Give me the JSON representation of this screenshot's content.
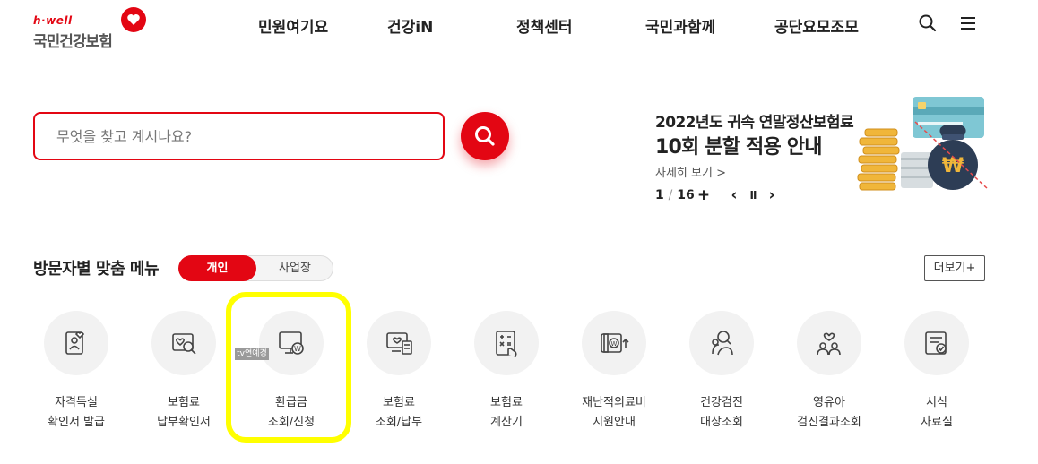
{
  "header": {
    "logo_sub": "h·well",
    "logo_main": "국민건강보험",
    "nav": [
      "민원여기요",
      "건강iN",
      "정책센터",
      "국민과함께",
      "공단요모조모"
    ],
    "icons": [
      "search-icon",
      "menu-icon"
    ]
  },
  "search": {
    "placeholder": "무엇을 찾고 계시나요?",
    "value": "",
    "button_icon": "search-icon"
  },
  "banner": {
    "subtitle": "2022년도 귀속 연말정산보험료",
    "title": "10회 분할 적용 안내",
    "more_link": "자세히 보기 >",
    "page_current": "1",
    "page_sep": "/",
    "page_total": "16",
    "controls": {
      "add": "+",
      "prev": "‹",
      "pause": "II",
      "next": "›"
    }
  },
  "persona": {
    "title": "방문자별 맞춤 메뉴",
    "tab_active": "개인",
    "tab_inactive": "사업장",
    "more_button": "더보기+",
    "items": [
      {
        "line1": "자격득실",
        "line2": "확인서 발급",
        "icon": "id-card-icon"
      },
      {
        "line1": "보험료",
        "line2": "납부확인서",
        "icon": "search-document-icon"
      },
      {
        "line1": "환급금",
        "line2": "조회/신청",
        "icon": "refund-monitor-icon"
      },
      {
        "line1": "보험료",
        "line2": "조회/납부",
        "icon": "payment-monitor-icon"
      },
      {
        "line1": "보험료",
        "line2": "계산기",
        "icon": "calculator-icon"
      },
      {
        "line1": "재난적의료비",
        "line2": "지원안내",
        "icon": "wallet-icon"
      },
      {
        "line1": "건강검진",
        "line2": "대상조회",
        "icon": "people-search-icon"
      },
      {
        "line1": "영유아",
        "line2": "검진결과조회",
        "icon": "family-icon"
      },
      {
        "line1": "서식",
        "line2": "자료실",
        "icon": "form-document-icon"
      }
    ],
    "tooltip_tag": "tv연예경"
  },
  "colors": {
    "brand_red": "#e30613",
    "highlight_yellow": "#ffff00",
    "icon_circle": "#f2f2f2"
  }
}
